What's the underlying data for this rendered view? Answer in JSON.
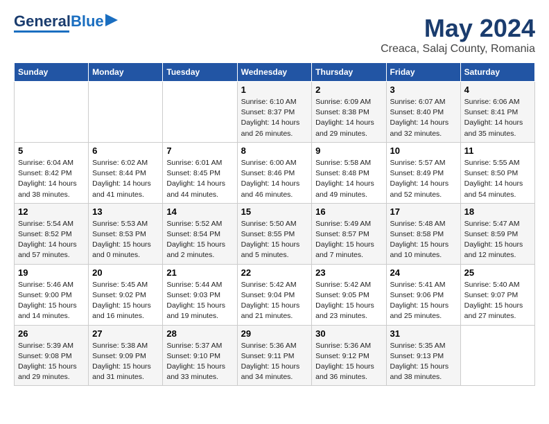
{
  "header": {
    "logo_general": "General",
    "logo_blue": "Blue",
    "month_year": "May 2024",
    "location": "Creaca, Salaj County, Romania"
  },
  "weekdays": [
    "Sunday",
    "Monday",
    "Tuesday",
    "Wednesday",
    "Thursday",
    "Friday",
    "Saturday"
  ],
  "weeks": [
    [
      {
        "num": "",
        "detail": ""
      },
      {
        "num": "",
        "detail": ""
      },
      {
        "num": "",
        "detail": ""
      },
      {
        "num": "1",
        "detail": "Sunrise: 6:10 AM\nSunset: 8:37 PM\nDaylight: 14 hours\nand 26 minutes."
      },
      {
        "num": "2",
        "detail": "Sunrise: 6:09 AM\nSunset: 8:38 PM\nDaylight: 14 hours\nand 29 minutes."
      },
      {
        "num": "3",
        "detail": "Sunrise: 6:07 AM\nSunset: 8:40 PM\nDaylight: 14 hours\nand 32 minutes."
      },
      {
        "num": "4",
        "detail": "Sunrise: 6:06 AM\nSunset: 8:41 PM\nDaylight: 14 hours\nand 35 minutes."
      }
    ],
    [
      {
        "num": "5",
        "detail": "Sunrise: 6:04 AM\nSunset: 8:42 PM\nDaylight: 14 hours\nand 38 minutes."
      },
      {
        "num": "6",
        "detail": "Sunrise: 6:02 AM\nSunset: 8:44 PM\nDaylight: 14 hours\nand 41 minutes."
      },
      {
        "num": "7",
        "detail": "Sunrise: 6:01 AM\nSunset: 8:45 PM\nDaylight: 14 hours\nand 44 minutes."
      },
      {
        "num": "8",
        "detail": "Sunrise: 6:00 AM\nSunset: 8:46 PM\nDaylight: 14 hours\nand 46 minutes."
      },
      {
        "num": "9",
        "detail": "Sunrise: 5:58 AM\nSunset: 8:48 PM\nDaylight: 14 hours\nand 49 minutes."
      },
      {
        "num": "10",
        "detail": "Sunrise: 5:57 AM\nSunset: 8:49 PM\nDaylight: 14 hours\nand 52 minutes."
      },
      {
        "num": "11",
        "detail": "Sunrise: 5:55 AM\nSunset: 8:50 PM\nDaylight: 14 hours\nand 54 minutes."
      }
    ],
    [
      {
        "num": "12",
        "detail": "Sunrise: 5:54 AM\nSunset: 8:52 PM\nDaylight: 14 hours\nand 57 minutes."
      },
      {
        "num": "13",
        "detail": "Sunrise: 5:53 AM\nSunset: 8:53 PM\nDaylight: 15 hours\nand 0 minutes."
      },
      {
        "num": "14",
        "detail": "Sunrise: 5:52 AM\nSunset: 8:54 PM\nDaylight: 15 hours\nand 2 minutes."
      },
      {
        "num": "15",
        "detail": "Sunrise: 5:50 AM\nSunset: 8:55 PM\nDaylight: 15 hours\nand 5 minutes."
      },
      {
        "num": "16",
        "detail": "Sunrise: 5:49 AM\nSunset: 8:57 PM\nDaylight: 15 hours\nand 7 minutes."
      },
      {
        "num": "17",
        "detail": "Sunrise: 5:48 AM\nSunset: 8:58 PM\nDaylight: 15 hours\nand 10 minutes."
      },
      {
        "num": "18",
        "detail": "Sunrise: 5:47 AM\nSunset: 8:59 PM\nDaylight: 15 hours\nand 12 minutes."
      }
    ],
    [
      {
        "num": "19",
        "detail": "Sunrise: 5:46 AM\nSunset: 9:00 PM\nDaylight: 15 hours\nand 14 minutes."
      },
      {
        "num": "20",
        "detail": "Sunrise: 5:45 AM\nSunset: 9:02 PM\nDaylight: 15 hours\nand 16 minutes."
      },
      {
        "num": "21",
        "detail": "Sunrise: 5:44 AM\nSunset: 9:03 PM\nDaylight: 15 hours\nand 19 minutes."
      },
      {
        "num": "22",
        "detail": "Sunrise: 5:42 AM\nSunset: 9:04 PM\nDaylight: 15 hours\nand 21 minutes."
      },
      {
        "num": "23",
        "detail": "Sunrise: 5:42 AM\nSunset: 9:05 PM\nDaylight: 15 hours\nand 23 minutes."
      },
      {
        "num": "24",
        "detail": "Sunrise: 5:41 AM\nSunset: 9:06 PM\nDaylight: 15 hours\nand 25 minutes."
      },
      {
        "num": "25",
        "detail": "Sunrise: 5:40 AM\nSunset: 9:07 PM\nDaylight: 15 hours\nand 27 minutes."
      }
    ],
    [
      {
        "num": "26",
        "detail": "Sunrise: 5:39 AM\nSunset: 9:08 PM\nDaylight: 15 hours\nand 29 minutes."
      },
      {
        "num": "27",
        "detail": "Sunrise: 5:38 AM\nSunset: 9:09 PM\nDaylight: 15 hours\nand 31 minutes."
      },
      {
        "num": "28",
        "detail": "Sunrise: 5:37 AM\nSunset: 9:10 PM\nDaylight: 15 hours\nand 33 minutes."
      },
      {
        "num": "29",
        "detail": "Sunrise: 5:36 AM\nSunset: 9:11 PM\nDaylight: 15 hours\nand 34 minutes."
      },
      {
        "num": "30",
        "detail": "Sunrise: 5:36 AM\nSunset: 9:12 PM\nDaylight: 15 hours\nand 36 minutes."
      },
      {
        "num": "31",
        "detail": "Sunrise: 5:35 AM\nSunset: 9:13 PM\nDaylight: 15 hours\nand 38 minutes."
      },
      {
        "num": "",
        "detail": ""
      }
    ]
  ]
}
